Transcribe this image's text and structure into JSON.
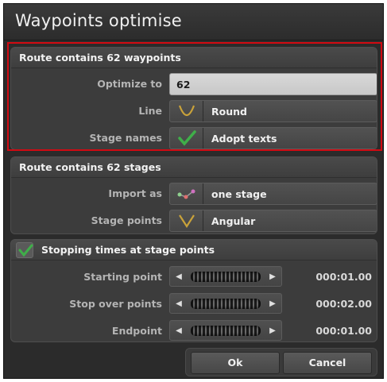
{
  "dialog": {
    "title": "Waypoints optimise"
  },
  "waypoints": {
    "header": "Route contains 62 waypoints",
    "optimize_label": "Optimize to",
    "optimize_value": "62",
    "line_label": "Line",
    "line_value": "Round",
    "line_icon": "round-curve-icon",
    "stage_names_label": "Stage names",
    "stage_names_value": "Adopt texts",
    "stage_names_icon": "checkmark-icon"
  },
  "stages": {
    "header": "Route contains 62 stages",
    "import_label": "Import as",
    "import_value": "one stage",
    "import_icon": "stage-points-icon",
    "points_label": "Stage points",
    "points_value": "Angular",
    "points_icon": "angular-curve-icon"
  },
  "stopping": {
    "header": "Stopping times at stage points",
    "checked": true,
    "rows": [
      {
        "label": "Starting point",
        "time": "000:01.00"
      },
      {
        "label": "Stop over points",
        "time": "000:02.00"
      },
      {
        "label": "Endpoint",
        "time": "000:01.00"
      }
    ]
  },
  "buttons": {
    "ok": "Ok",
    "cancel": "Cancel"
  },
  "colors": {
    "highlight": "#d10a12",
    "accent_gold": "#c9a23a",
    "check_green": "#3fae49"
  }
}
